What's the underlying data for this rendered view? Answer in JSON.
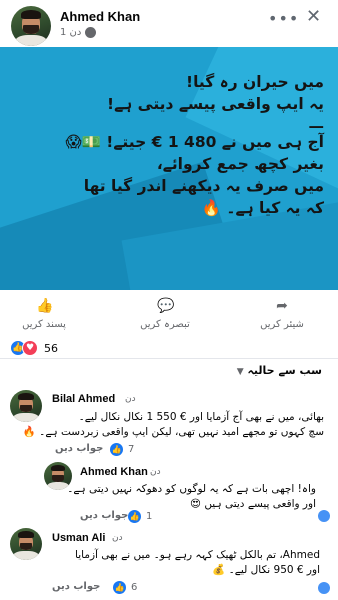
{
  "post": {
    "author": "Ahmed Khan",
    "time": "1 دن",
    "menu_icon": "more-dots-icon",
    "close_icon": "close-icon"
  },
  "banner": {
    "lines": [
      "میں حیران رہ گیا!",
      "یہ ایپ واقعی پیسے دیتی ہے!",
      "—",
      "آج ہی میں نے 480 1 € جیتے! 💵😱",
      "بغیر کچھ جمع کروائے،",
      "میں صرف یہ دیکھنے اندر گیا تھا",
      "کہ یہ کیا ہے۔ 🔥"
    ]
  },
  "actions": {
    "share": "شیئر کریں",
    "comment": "تبصرہ کریں",
    "like": "پسند کریں"
  },
  "reactions": {
    "count": "56"
  },
  "sort_label": "سب سے حالیہ",
  "comments": [
    {
      "name": "Bilal Ahmed",
      "time": "دن",
      "lines": [
        "بھائی، میں نے بھی آج آزمایا اور € 550 1 نکال نکال لیے۔",
        "سچ کہوں تو مجھے امید نہیں تھی، لیکن ایپ واقعی زبردست ہے۔ 🔥"
      ],
      "reply": "جواب دیں",
      "likes": "7"
    },
    {
      "name": "Ahmed Khan",
      "time": "دن",
      "lines": [
        "واہ! اچھی بات ہے کہ یہ لوگوں کو دھوکہ نہیں دیتی ہے۔",
        "اور واقعی پیسے دیتی ہیں 😍"
      ],
      "reply": "جواب دیں",
      "likes": "1"
    },
    {
      "name": "Usman Ali",
      "time": "دن",
      "lines": [
        "Ahmed، تم بالکل ٹھیک کہہ رہے ہو۔ میں نے بھی آزمایا",
        "اور € 950 نکال لیے۔ 💰"
      ],
      "reply": "جواب دیں",
      "likes": "6"
    }
  ],
  "colors": {
    "accent": "#1877f2",
    "banner": "#1fa0cf",
    "love": "#f33e58"
  }
}
